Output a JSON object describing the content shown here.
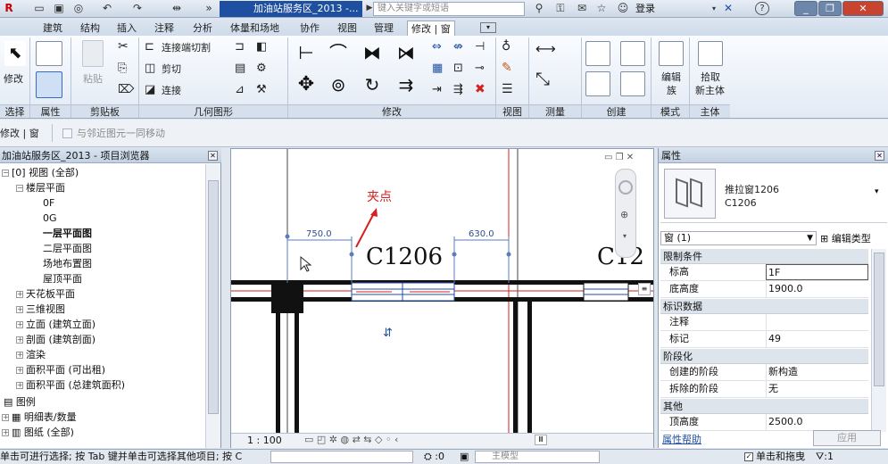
{
  "titlebar": {
    "app_title": "加油站服务区_2013 -...",
    "search_placeholder": "键入关键字或短语",
    "login": "登录",
    "help": "?"
  },
  "tabs": [
    "建筑",
    "结构",
    "插入",
    "注释",
    "分析",
    "体量和场地",
    "协作",
    "视图",
    "管理",
    "修改 | 窗"
  ],
  "ribbon": {
    "modify": "修改",
    "paste": "粘贴",
    "cope": "连接端切割",
    "cut": "剪切",
    "join": "连接",
    "edit_family_1": "编辑",
    "edit_family_2": "族",
    "pick_host_1": "拾取",
    "pick_host_2": "新主体",
    "panels": {
      "select": "选择",
      "properties": "属性",
      "clipboard": "剪贴板",
      "geometry": "几何图形",
      "modify": "修改",
      "view": "视图",
      "measure": "测量",
      "create": "创建",
      "mode": "模式",
      "host": "主体"
    }
  },
  "optbar": {
    "context": "修改 | 窗",
    "move_with_nearby": "与邻近图元一同移动"
  },
  "browser": {
    "title": "加油站服务区_2013 - 项目浏览器",
    "items": [
      {
        "label": "[0] 视图 (全部)",
        "bold": false
      },
      {
        "label": "楼层平面",
        "bold": false
      },
      {
        "label": "0F",
        "bold": false
      },
      {
        "label": "0G",
        "bold": false
      },
      {
        "label": "一层平面图",
        "bold": true
      },
      {
        "label": "二层平面图",
        "bold": false
      },
      {
        "label": "场地布置图",
        "bold": false
      },
      {
        "label": "屋顶平面",
        "bold": false
      },
      {
        "label": "天花板平面",
        "bold": false
      },
      {
        "label": "三维视图",
        "bold": false
      },
      {
        "label": "立面 (建筑立面)",
        "bold": false
      },
      {
        "label": "剖面 (建筑剖面)",
        "bold": false
      },
      {
        "label": "渲染",
        "bold": false
      },
      {
        "label": "面积平面 (可出租)",
        "bold": false
      },
      {
        "label": "面积平面 (总建筑面积)",
        "bold": false
      },
      {
        "label": "图例",
        "bold": false
      },
      {
        "label": "明细表/数量",
        "bold": false
      },
      {
        "label": "图纸 (全部)",
        "bold": false
      }
    ]
  },
  "canvas": {
    "annotation": "夹点",
    "dim_left": "750.0",
    "dim_right": "630.0",
    "tag_main": "C1206",
    "tag_right": "C12",
    "scale": "1 : 100"
  },
  "properties": {
    "title": "属性",
    "type_name_1": "推拉窗1206",
    "type_name_2": "C1206",
    "instance_selector": "窗 (1)",
    "edit_type": "编辑类型",
    "groups": {
      "constraints": "限制条件",
      "identity": "标识数据",
      "phasing": "阶段化",
      "other": "其他"
    },
    "rows": {
      "level_k": "标高",
      "level_v": "1F",
      "sill_k": "底高度",
      "sill_v": "1900.0",
      "comments_k": "注释",
      "comments_v": "",
      "mark_k": "标记",
      "mark_v": "49",
      "phase_created_k": "创建的阶段",
      "phase_created_v": "新构造",
      "phase_demo_k": "拆除的阶段",
      "phase_demo_v": "无",
      "head_k": "顶高度",
      "head_v": "2500.0"
    },
    "help_link": "属性帮助",
    "apply": "应用"
  },
  "statusbar": {
    "hint": "单击可进行选择; 按 Tab 键并单击可选择其他项目; 按 C",
    "zero": ":0",
    "model": "主模型",
    "drag": "单击和拖曳",
    "filter": ":1"
  },
  "colors": {
    "accent": "#1f4fa0",
    "red": "#d61f1f",
    "ribbon": "#e8eef6"
  }
}
